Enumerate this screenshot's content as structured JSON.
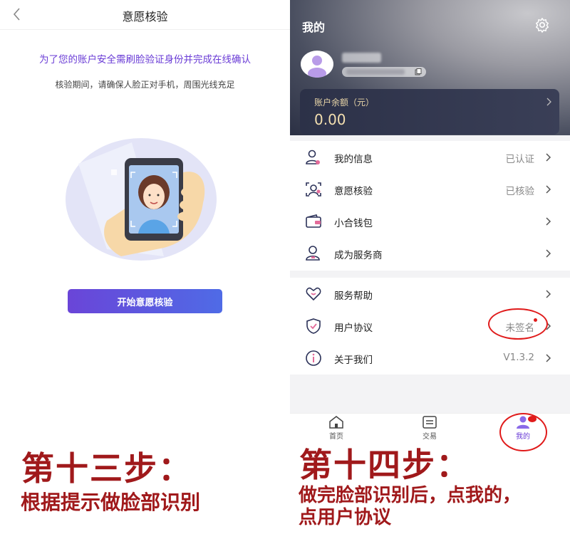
{
  "left": {
    "nav_title": "意愿核验",
    "notice": "为了您的账户安全需刷脸验证身份并完成在线确认",
    "tip": "核验期间，请确保人脸正对手机，周围光线充足",
    "start_button": "开始意愿核验"
  },
  "right": {
    "title": "我的",
    "balance": {
      "label": "账户余额（元）",
      "value": "0.00"
    },
    "menu_group1": [
      {
        "label": "我的信息",
        "value": "已认证",
        "icon": "user-info-icon"
      },
      {
        "label": "意愿核验",
        "value": "已核验",
        "icon": "face-scan-icon"
      },
      {
        "label": "小合钱包",
        "value": "",
        "icon": "wallet-icon"
      },
      {
        "label": "成为服务商",
        "value": "",
        "icon": "provider-icon"
      }
    ],
    "menu_group2": [
      {
        "label": "服务帮助",
        "value": "",
        "icon": "help-heart-icon"
      },
      {
        "label": "用户协议",
        "value": "未签名",
        "icon": "shield-check-icon"
      },
      {
        "label": "关于我们",
        "value": "V1.3.2",
        "icon": "info-icon"
      }
    ],
    "tabs": [
      {
        "label": "首页",
        "icon": "home-icon"
      },
      {
        "label": "交易",
        "icon": "trade-icon"
      },
      {
        "label": "我的",
        "icon": "profile-icon"
      }
    ]
  },
  "captions": {
    "step13_title": "第十三步：",
    "step13_sub": "根据提示做脸部识别",
    "step14_title": "第十四步：",
    "step14_sub1": "做完脸部识别后，点我的，",
    "step14_sub2": "点用户协议"
  },
  "colors": {
    "accent_purple": "#6a3cd6",
    "caption_red": "#a0191b",
    "annotation_red": "#e01b1b",
    "card_gold": "#f3dfb0"
  }
}
